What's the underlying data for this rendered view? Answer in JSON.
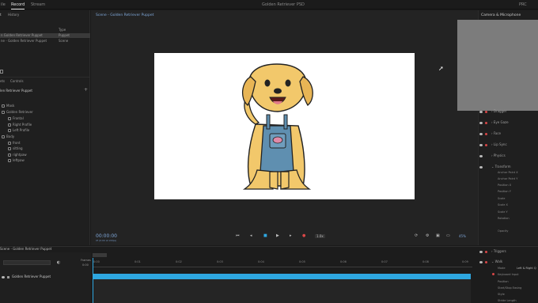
{
  "topbar": {
    "tabs": [
      "ile",
      "Record",
      "Stream"
    ],
    "window_title": "Golden Retriever PSD",
    "right_label": "PRC"
  },
  "left_panel": {
    "top_tabs": [
      "t",
      "History"
    ],
    "columns": {
      "type": "Type"
    },
    "project_rows": [
      {
        "name": "n Golden Retriever Puppet",
        "type": "Puppet"
      },
      {
        "name": "ne - Golden Retriever Puppet",
        "type": "Scene"
      }
    ],
    "bottom_tabs": [
      "ets",
      "Controls"
    ],
    "puppet_header": "len Retriever Puppet",
    "tree": [
      "Mask",
      "Golden Retriever",
      "Frontal",
      "Right Profile",
      "Left Profile",
      "Body",
      "front",
      "sitting",
      "rightpaw",
      "leftpaw"
    ]
  },
  "center": {
    "scene_title": "Scene - Golden Retriever Puppet",
    "timecode": "00:00:00",
    "timecode_sub": "0f (0:00 at 24fps)",
    "zoom_label": "1.0x",
    "zoom_percent": "45%"
  },
  "right_panel": {
    "header": "Camera & Microphone",
    "sections": [
      "Dragger",
      "Eye Gaze",
      "Face",
      "Lip Sync",
      "Physics",
      "Transform"
    ],
    "transform_props": [
      "Anchor Point X",
      "Anchor Point Y",
      "Position X",
      "Position Y",
      "Scale",
      "Scale X",
      "Scale Y",
      "Rotation",
      "Opacity"
    ],
    "lower_sections": [
      "Triggers",
      "Walk"
    ],
    "walk_props": [
      {
        "label": "Mode",
        "value": "Left & Right Q"
      },
      {
        "label": "Keyboard Input",
        "value": ""
      },
      {
        "label": "Position",
        "value": ""
      },
      {
        "label": "Start/Stop Easing",
        "value": ""
      },
      {
        "label": "Style",
        "value": ""
      },
      {
        "label": "Stride Length",
        "value": ""
      }
    ]
  },
  "timeline": {
    "panel_title": "Scene - Golden Retriever Puppet",
    "frames_label": "Frames",
    "frames_value": "0:00",
    "track_name": "Golden Retriever Puppet",
    "ruler_times": [
      "0:00",
      "0:01",
      "0:02",
      "0:03",
      "0:04",
      "0:05",
      "0:06",
      "0:07",
      "0:08",
      "0:09"
    ]
  },
  "colors": {
    "accent_blue": "#2ea7e0",
    "record_red": "#d94747",
    "scene_link": "#7fa7d9"
  }
}
